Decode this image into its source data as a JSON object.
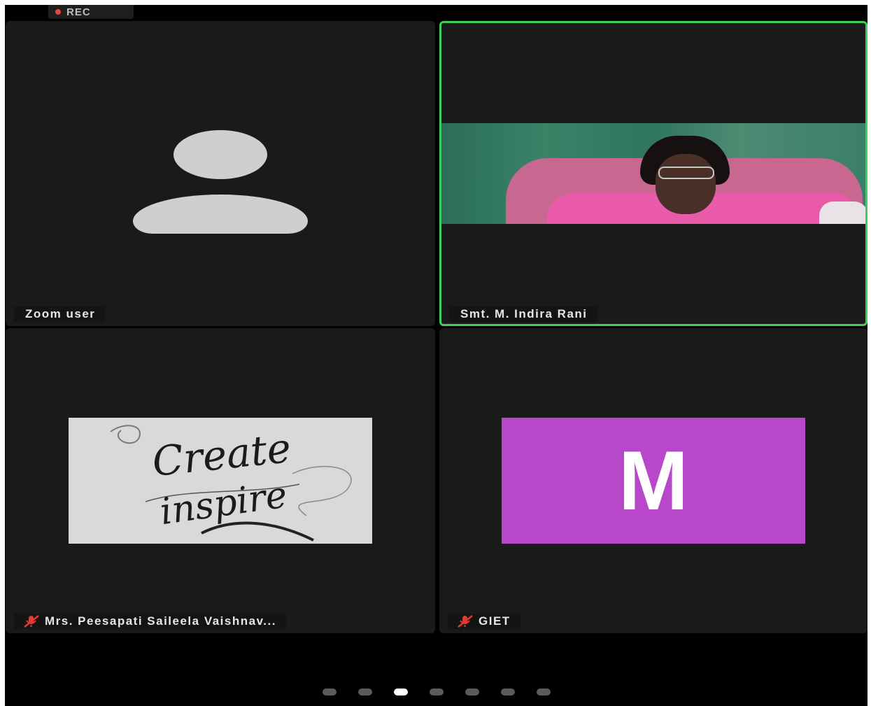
{
  "recording": {
    "label": "REC"
  },
  "participants": [
    {
      "name": "Zoom user",
      "video": "avatar-placeholder",
      "muted": false,
      "active_speaker": false
    },
    {
      "name": "Smt. M. Indira Rani",
      "video": "camera",
      "muted": false,
      "active_speaker": true
    },
    {
      "name": "Mrs. Peesapati Saileela Vaishnav...",
      "video": "profile-picture",
      "profile_text": [
        "Create",
        "inspire"
      ],
      "muted": true,
      "active_speaker": false
    },
    {
      "name": "GIET",
      "video": "initial",
      "initial": "M",
      "muted": true,
      "active_speaker": false
    }
  ],
  "pagination": {
    "total_pages": 7,
    "current_page": 3
  },
  "colors": {
    "active_speaker_border": "#3fcf58",
    "initial_avatar_bg": "#b648c9",
    "recording_dot": "#e64545",
    "muted_icon": "#e53935"
  }
}
